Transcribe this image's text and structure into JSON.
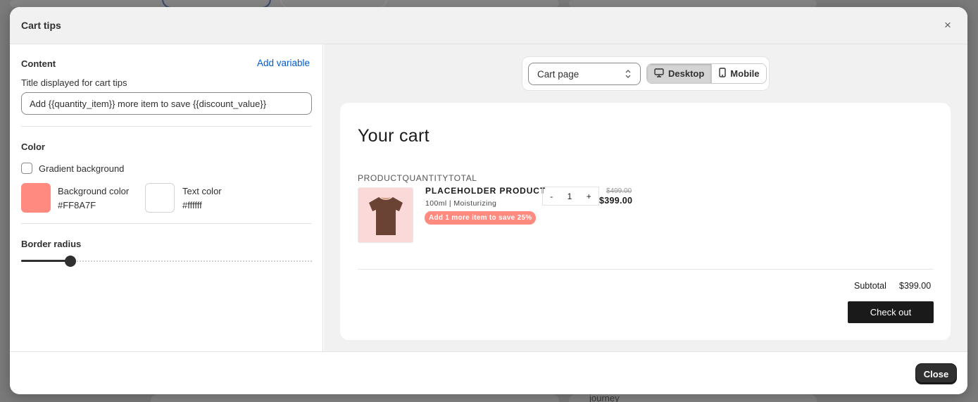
{
  "background_app": {
    "partial_text": "journey"
  },
  "modal": {
    "title": "Cart tips",
    "close_icon": "×",
    "footer": {
      "close_label": "Close"
    }
  },
  "settings": {
    "content": {
      "heading": "Content",
      "add_variable_label": "Add variable",
      "title_label": "Title displayed for cart tips",
      "title_value": "Add {{quantity_item}} more item to save {{discount_value}}"
    },
    "color": {
      "heading": "Color",
      "gradient_label": "Gradient background",
      "gradient_checked": false,
      "background": {
        "label": "Background color",
        "hex": "#FF8A7F"
      },
      "text": {
        "label": "Text color",
        "hex": "#ffffff"
      }
    },
    "border_radius": {
      "heading": "Border radius",
      "slider_fraction": 0.17
    }
  },
  "preview": {
    "page_select": {
      "value": "Cart page"
    },
    "device_toggle": {
      "options": [
        "Desktop",
        "Mobile"
      ],
      "selected": "Desktop"
    },
    "cart": {
      "title": "Your cart",
      "columns": [
        "PRODUCT",
        "QUANTITY",
        "TOTAL"
      ],
      "item": {
        "name": "PLACEHOLDER PRODUCT",
        "variant": "100ml | Moisturizing",
        "tip": "Add 1 more item to save 25%",
        "quantity": "1",
        "minus": "-",
        "plus": "+",
        "compare_price": "$499.00",
        "price": "$399.00"
      },
      "subtotal_label": "Subtotal",
      "subtotal_value": "$399.00",
      "checkout_label": "Check out"
    }
  }
}
